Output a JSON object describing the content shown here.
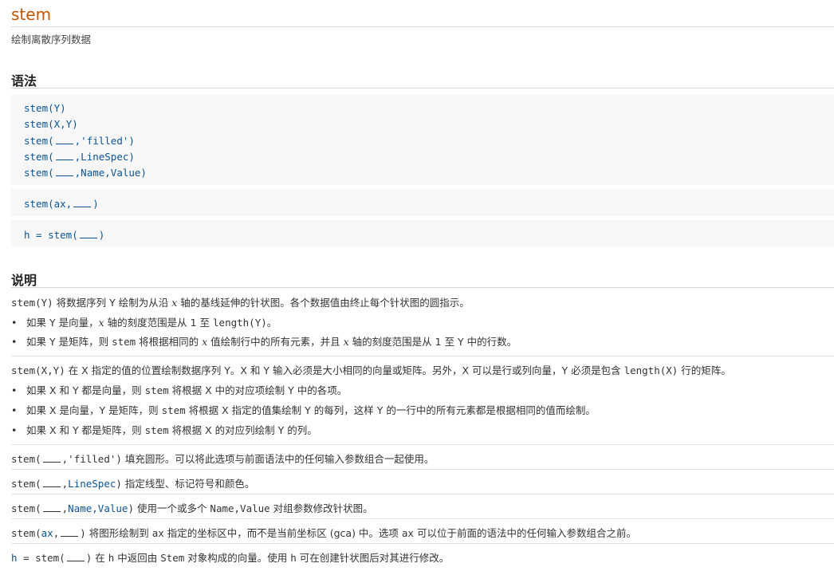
{
  "page": {
    "title": "stem",
    "subtitle": "绘制离散序列数据"
  },
  "syntax": {
    "heading": "语法",
    "lines": [
      {
        "pre": "stem(Y)",
        "post": ""
      },
      {
        "pre": "stem(X,Y)",
        "post": ""
      },
      {
        "pre": "stem(",
        "post": ",'filled')"
      },
      {
        "pre": "stem(",
        "post": ",LineSpec)"
      },
      {
        "pre": "stem(",
        "post": ",Name,Value)"
      },
      {
        "pre": "stem(ax,",
        "post": ")"
      },
      {
        "pre": "h = stem(",
        "post": ")"
      }
    ]
  },
  "description": {
    "heading": "说明",
    "p1": {
      "code": "stem(Y)",
      "t1": " 将数据序列 Y 绘制为从沿 ",
      "x": "x",
      "t2": " 轴的基线延伸的针状图。各个数据值由终止每个针状图的圆指示。"
    },
    "p1_bullets": [
      {
        "t1": "如果 Y 是向量，",
        "x": "x",
        "t2": " 轴的刻度范围是从 1 至 ",
        "code": "length(Y)",
        "t3": "。"
      },
      {
        "t1": "如果 Y 是矩阵，则 ",
        "code": "stem",
        "t2": " 将根据相同的 ",
        "x": "x",
        "t3": " 值绘制行中的所有元素，并且 ",
        "x2": "x",
        "t4": " 轴的刻度范围是从 1 至 Y 中的行数。"
      }
    ],
    "p2": {
      "code": "stem(X,Y)",
      "t1": " 在 X 指定的值的位置绘制数据序列 Y。X 和 Y 输入必须是大小相同的向量或矩阵。另外，X 可以是行或列向量，Y 必须是包含 ",
      "code2": "length(X)",
      "t2": " 行的矩阵。"
    },
    "p2_bullets": [
      {
        "t1": "如果 X 和 Y 都是向量，则 ",
        "code": "stem",
        "t2": " 将根据 X 中的对应项绘制 Y 中的各项。"
      },
      {
        "t1": "如果 X 是向量，Y 是矩阵，则 ",
        "code": "stem",
        "t2": " 将根据 X 指定的值集绘制 Y 的每列，这样 Y 的一行中的所有元素都是根据相同的值而绘制。"
      },
      {
        "t1": "如果 X 和 Y 都是矩阵，则 ",
        "code": "stem",
        "t2": " 将根据 X 的对应列绘制 Y 的列。"
      }
    ],
    "p3": {
      "pre": "stem(",
      "post": ",'filled')",
      "text": " 填充圆形。可以将此选项与前面语法中的任何输入参数组合一起使用。"
    },
    "p4": {
      "pre": "stem(",
      "mid": ",",
      "arg": "LineSpec",
      "post": ")",
      "text": " 指定线型、标记符号和颜色。"
    },
    "p5": {
      "pre": "stem(",
      "mid": ",",
      "arg": "Name,Value",
      "post": ")",
      "text1": " 使用一个或多个 ",
      "code": "Name,Value",
      "text2": " 对组参数修改针状图。"
    },
    "p6": {
      "pre": "stem(",
      "arg": "ax",
      "mid": ",",
      "post": ")",
      "text1": " 将图形绘制到 ",
      "code": "ax",
      "text2": " 指定的坐标区中，而不是当前坐标区 (gca) 中。选项 ",
      "code2": "ax",
      "text3": " 可以位于前面的语法中的任何输入参数组合之前。"
    },
    "p7": {
      "arg": "h",
      "pre": " = stem(",
      "post": ")",
      "text1": " 在 ",
      "code": "h",
      "text2": " 中返回由 ",
      "code2": "Stem",
      "text3": " 对象构成的向量。使用 ",
      "code3": "h",
      "text4": " 可在创建针状图后对其进行修改。"
    }
  }
}
